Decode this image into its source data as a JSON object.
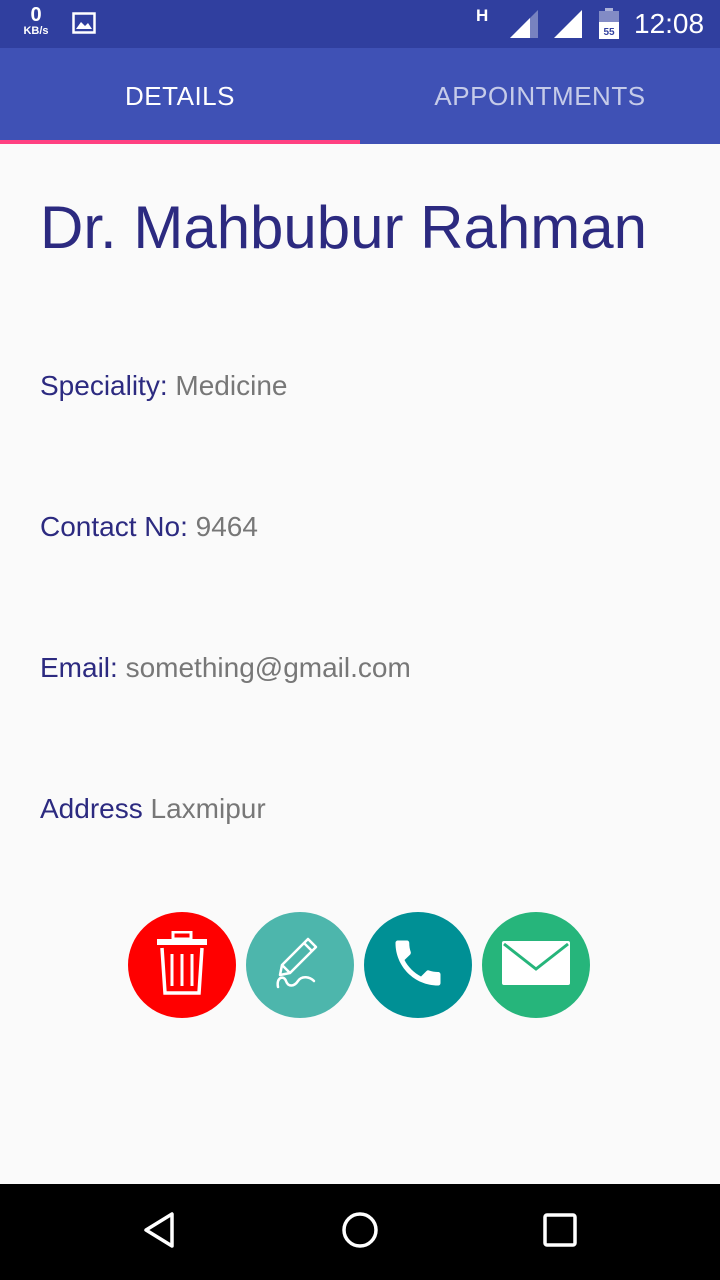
{
  "status_bar": {
    "speed_value": "0",
    "speed_unit": "KB/s",
    "network_type": "H",
    "battery_level": "55",
    "time": "12:08"
  },
  "tabs": [
    {
      "label": "DETAILS",
      "selected": true
    },
    {
      "label": "APPOINTMENTS",
      "selected": false
    }
  ],
  "doctor": {
    "name": "Dr. Mahbubur Rahman",
    "speciality_label": "Speciality:",
    "speciality_value": "Medicine",
    "contact_label": "Contact No:",
    "contact_value": "9464",
    "email_label": "Email:",
    "email_value": "something@gmail.com",
    "address_label": "Address",
    "address_value": "Laxmipur"
  },
  "actions": [
    {
      "icon": "trash-icon",
      "color": "#ff0000"
    },
    {
      "icon": "edit-pencil-icon",
      "color": "#4db6ac"
    },
    {
      "icon": "phone-icon",
      "color": "#009095"
    },
    {
      "icon": "envelope-icon",
      "color": "#26b57b"
    }
  ],
  "colors": {
    "status_bar": "#303f9f",
    "tab_bar": "#3f51b5",
    "tab_indicator": "#ff4081",
    "label_text": "#2c2a80",
    "value_text": "#777777"
  },
  "nav": [
    "back-icon",
    "home-icon",
    "recents-icon"
  ]
}
